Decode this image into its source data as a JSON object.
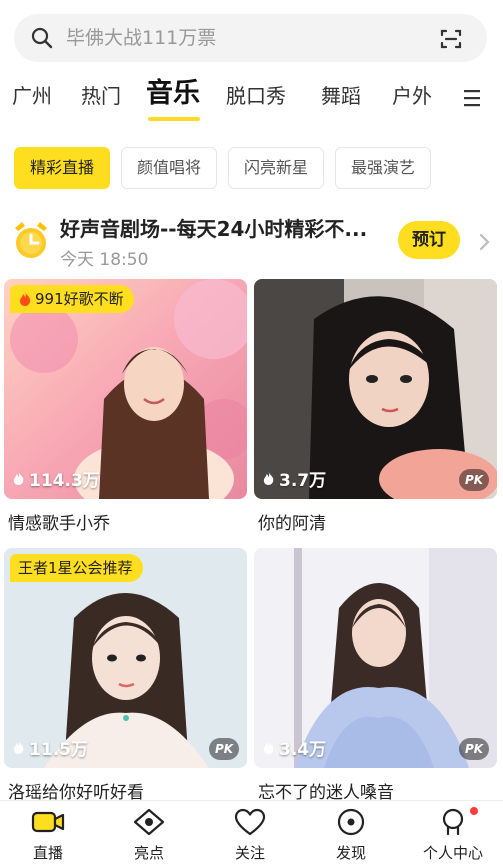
{
  "search": {
    "placeholder": "毕佛大战111万票"
  },
  "tabs": [
    {
      "label": "广州"
    },
    {
      "label": "热门"
    },
    {
      "label": "音乐",
      "active": true
    },
    {
      "label": "脱口秀"
    },
    {
      "label": "舞蹈"
    },
    {
      "label": "户外"
    }
  ],
  "subtabs": [
    {
      "label": "精彩直播",
      "active": true
    },
    {
      "label": "颜值唱将"
    },
    {
      "label": "闪亮新星"
    },
    {
      "label": "最强演艺"
    }
  ],
  "reservation": {
    "title": "好声音剧场--每天24小时精彩不...",
    "time": "今天 18:50",
    "button": "预订"
  },
  "cards": [
    {
      "badge": "991好歌不断",
      "badge_icon": "fire-icon",
      "views": "114.3万",
      "name": "情感歌手小乔",
      "pk": ""
    },
    {
      "badge": "",
      "views": "3.7万",
      "name": "你的阿清",
      "pk": "PK"
    },
    {
      "badge": "王者1星公会推荐",
      "views": "11.5万",
      "name": "洛瑶给你好听好看",
      "pk": "PK"
    },
    {
      "badge": "",
      "views": "3.4万",
      "name": "忘不了的迷人嗓音",
      "pk": "PK"
    }
  ],
  "bottom_nav": [
    {
      "label": "直播",
      "icon": "live-camera-icon",
      "active": true
    },
    {
      "label": "亮点",
      "icon": "eye-icon"
    },
    {
      "label": "关注",
      "icon": "heart-icon"
    },
    {
      "label": "发现",
      "icon": "compass-icon"
    },
    {
      "label": "个人中心",
      "icon": "person-icon",
      "badge_dot": true
    }
  ],
  "colors": {
    "accent": "#ffdd1f",
    "text": "#222222",
    "muted": "#999999",
    "notice": "#ff3b3b"
  }
}
